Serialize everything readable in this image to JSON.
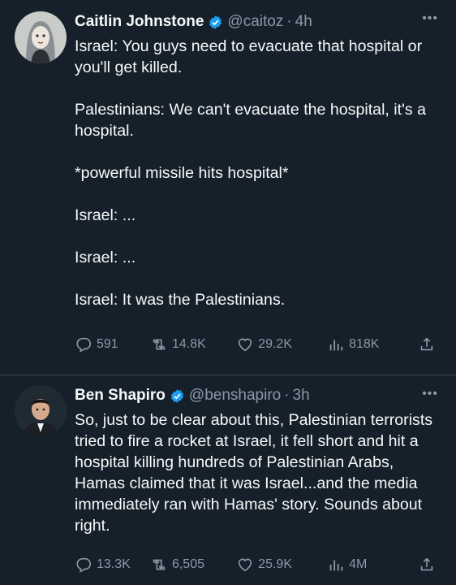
{
  "colors": {
    "background": "#15202b",
    "text": "#f7f9f9",
    "secondary": "#8b98a5",
    "verified": "#1d9bf0",
    "divider": "#38444d"
  },
  "tweets": [
    {
      "author_name": "Caitlin Johnstone",
      "handle": "@caitoz",
      "separator": "·",
      "time": "4h",
      "more": "•••",
      "text": "Israel: You guys need to evacuate that hospital or you'll get killed.\n\nPalestinians: We can't evacuate the hospital, it's a hospital.\n\n*powerful missile hits hospital*\n\nIsrael: ...\n\nIsrael: ...\n\nIsrael: It was the Palestinians.",
      "replies": "591",
      "retweets": "14.8K",
      "likes": "29.2K",
      "views": "818K"
    },
    {
      "author_name": "Ben Shapiro",
      "handle": "@benshapiro",
      "separator": "·",
      "time": "3h",
      "more": "•••",
      "text": "So, just to be clear about this, Palestinian terrorists tried to fire a rocket at Israel, it fell short and hit a hospital killing hundreds of Palestinian Arabs, Hamas claimed that it was Israel...and the media immediately ran with Hamas' story. Sounds about right.",
      "replies": "13.3K",
      "retweets": "6,505",
      "likes": "25.9K",
      "views": "4M"
    }
  ]
}
